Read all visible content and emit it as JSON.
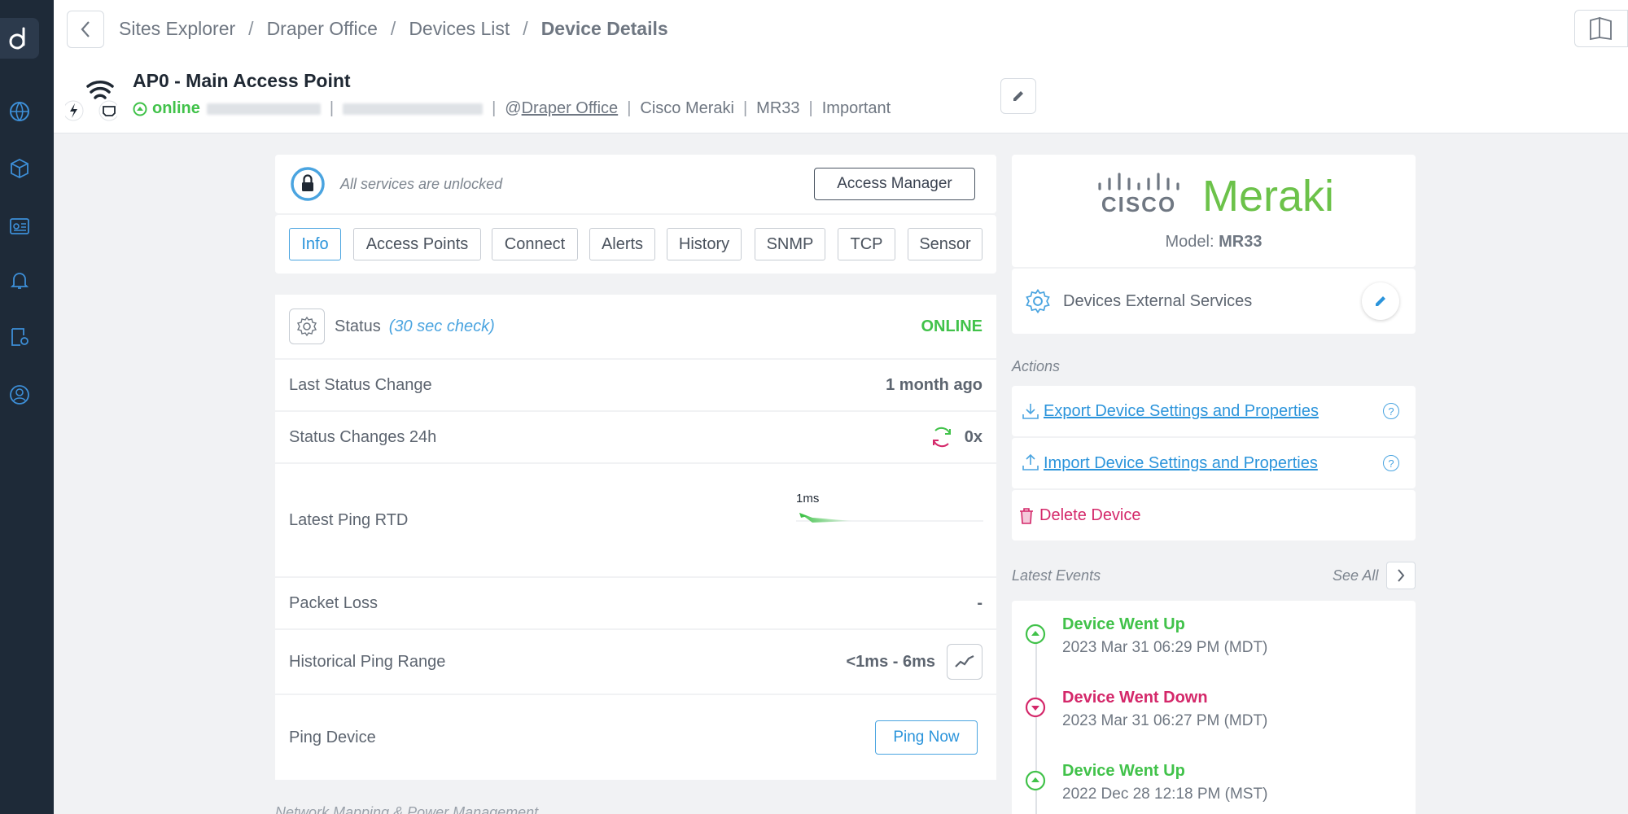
{
  "breadcrumb": {
    "items": [
      "Sites Explorer",
      "Draper Office",
      "Devices List"
    ],
    "current": "Device Details",
    "separator": "/"
  },
  "device": {
    "title": "AP0 - Main Access Point",
    "status": "online",
    "site_prefix": "@",
    "site": "Draper Office",
    "vendor": "Cisco Meraki",
    "model": "MR33",
    "importance": "Important"
  },
  "lock": {
    "text": "All services are unlocked",
    "button": "Access Manager"
  },
  "tabs": [
    "Info",
    "Access Points",
    "Connect",
    "Alerts",
    "History",
    "SNMP",
    "TCP",
    "Sensor"
  ],
  "active_tab": "Info",
  "info": {
    "status_label": "Status",
    "status_check": "(30 sec check)",
    "status_value": "ONLINE",
    "last_change_label": "Last Status Change",
    "last_change_value": "1 month ago",
    "changes_label": "Status Changes 24h",
    "changes_value": "0x",
    "ping_rtd_label": "Latest Ping RTD",
    "ping_rtd_value": "1ms",
    "packet_loss_label": "Packet Loss",
    "packet_loss_value": "-",
    "hist_label": "Historical Ping Range",
    "hist_value": "<1ms - 6ms",
    "ping_device_label": "Ping Device",
    "ping_button": "Ping Now",
    "next_section": "Network Mapping & Power Management"
  },
  "vendor_card": {
    "brand_cisco": "CISCO",
    "brand_meraki": "Meraki",
    "model_label": "Model:",
    "model_value": "MR33"
  },
  "external": {
    "label": "Devices External Services"
  },
  "actions": {
    "title": "Actions",
    "export": "Export Device Settings and Properties",
    "import": "Import Device Settings and Properties",
    "delete": "Delete Device",
    "help": "?"
  },
  "events": {
    "title": "Latest Events",
    "see_all": "See All",
    "items": [
      {
        "title": "Device Went Up",
        "time": "2023 Mar 31 06:29 PM (MDT)",
        "type": "up"
      },
      {
        "title": "Device Went Down",
        "time": "2023 Mar 31 06:27 PM (MDT)",
        "type": "down"
      },
      {
        "title": "Device Went Up",
        "time": "2022 Dec 28 12:18 PM (MST)",
        "type": "up"
      }
    ]
  },
  "colors": {
    "accent": "#2b94db",
    "online": "#41c24a",
    "danger": "#d4286a",
    "sidebar": "#1e2a38"
  }
}
